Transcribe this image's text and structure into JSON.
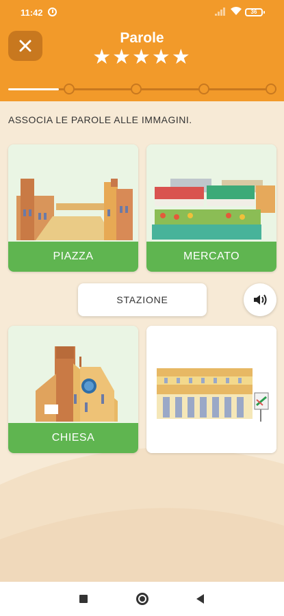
{
  "status_bar": {
    "time": "11:42",
    "battery": "36"
  },
  "header": {
    "title": "Parole",
    "stars": "★★★★★"
  },
  "progress": {
    "value": 0.19,
    "steps": 5
  },
  "exercise": {
    "instruction": "ASSOCIA LE PAROLE ALLE IMMAGINI.",
    "cards": [
      {
        "label": "PIAZZA",
        "image": "piazza-illustration"
      },
      {
        "label": "MERCATO",
        "image": "market-illustration"
      },
      {
        "label": "CHIESA",
        "image": "church-illustration"
      },
      {
        "label": "",
        "image": "station-illustration"
      }
    ],
    "current_word": "STAZIONE",
    "audio_icon": "speaker-icon"
  },
  "colors": {
    "header": "#f29a2a",
    "card_label": "#5fb550",
    "background": "#f7ead6"
  },
  "nav_bar": {
    "icons": [
      "recents-icon",
      "home-icon",
      "back-icon"
    ]
  }
}
